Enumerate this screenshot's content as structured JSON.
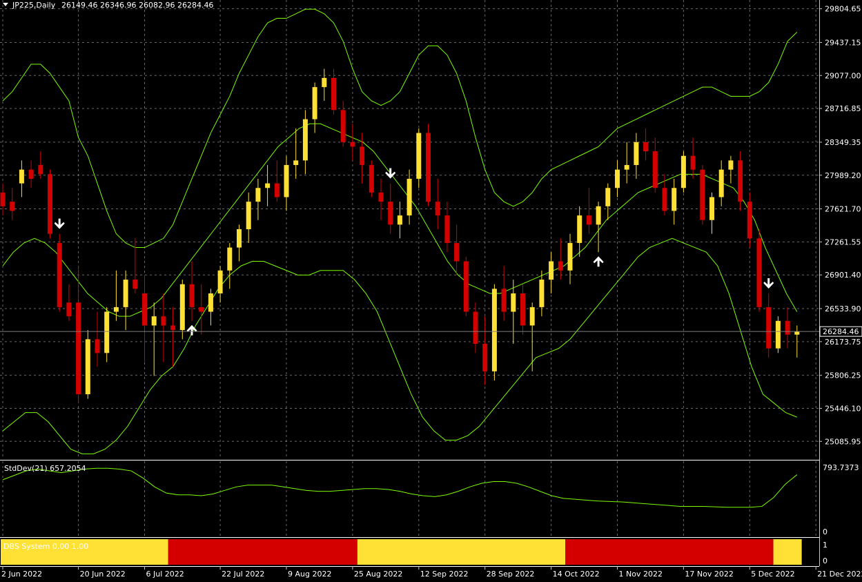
{
  "window": {
    "symbol_label": "JP225,Daily",
    "ohlc_label": "26149.46 26346.96 26082.96 26284.46"
  },
  "colors": {
    "background": "#000000",
    "grid": "#c0c0c0",
    "band": "#7cfc00",
    "candle_up": "#ffe135",
    "candle_down": "#d40000",
    "arrow": "#ffffff",
    "price_line": "#808080",
    "panel_border": "#ffffff"
  },
  "price_axis": {
    "ticks": [
      "29804.65",
      "29437.15",
      "29077.00",
      "28716.85",
      "28349.35",
      "27989.20",
      "27621.70",
      "27261.55",
      "26901.40",
      "26533.90",
      "26173.75",
      "25806.25",
      "25446.10",
      "25085.95"
    ],
    "current_price_label": "26284.46",
    "current_price": 26284.46
  },
  "stddev_panel": {
    "title": "StdDev(21) 657.2054",
    "axis_top": "793.7373",
    "axis_bottom": "0"
  },
  "dbs_panel": {
    "title": "DBS System 0.00 1.00",
    "axis_top": "1",
    "axis_bottom": "0",
    "segments": [
      {
        "state": 1,
        "from": 0,
        "to": 18
      },
      {
        "state": 0,
        "from": 18,
        "to": 38
      },
      {
        "state": 1,
        "from": 38,
        "to": 60
      },
      {
        "state": 0,
        "from": 60,
        "to": 82
      },
      {
        "state": 1,
        "from": 82,
        "to": 86
      }
    ]
  },
  "time_axis": {
    "labels": [
      {
        "text": "2 Jun 2022",
        "bar": 0
      },
      {
        "text": "20 Jun 2022",
        "bar": 8
      },
      {
        "text": "6 Jul 2022",
        "bar": 15
      },
      {
        "text": "22 Jul 2022",
        "bar": 23
      },
      {
        "text": "9 Aug 2022",
        "bar": 30
      },
      {
        "text": "25 Aug 2022",
        "bar": 37
      },
      {
        "text": "12 Sep 2022",
        "bar": 44
      },
      {
        "text": "28 Sep 2022",
        "bar": 51
      },
      {
        "text": "14 Oct 2022",
        "bar": 58
      },
      {
        "text": "1 Nov 2022",
        "bar": 65
      },
      {
        "text": "17 Nov 2022",
        "bar": 72
      },
      {
        "text": "5 Dec 2022",
        "bar": 79
      },
      {
        "text": "21 Dec 2022",
        "bar": 86
      }
    ]
  },
  "chart_data": {
    "type": "candlestick",
    "title": "JP225,Daily",
    "ylim": [
      24900,
      29900
    ],
    "candles": [
      [
        27800,
        27900,
        27550,
        27650
      ],
      [
        27700,
        27850,
        27500,
        27600
      ],
      [
        27900,
        28150,
        27750,
        28050
      ],
      [
        28050,
        28150,
        27850,
        27950
      ],
      [
        28100,
        28250,
        27950,
        28000
      ],
      [
        28000,
        28050,
        27300,
        27350
      ],
      [
        27250,
        27350,
        26500,
        26550
      ],
      [
        26600,
        26800,
        26400,
        26450
      ],
      [
        26600,
        27000,
        25500,
        25600
      ],
      [
        25600,
        26300,
        25550,
        26200
      ],
      [
        26200,
        26500,
        25900,
        26050
      ],
      [
        26050,
        26550,
        25950,
        26500
      ],
      [
        26500,
        26950,
        26400,
        26550
      ],
      [
        26550,
        26950,
        26300,
        26850
      ],
      [
        26850,
        27300,
        26700,
        26750
      ],
      [
        26700,
        26900,
        25950,
        26350
      ],
      [
        26350,
        26600,
        25800,
        26450
      ],
      [
        26450,
        26700,
        25950,
        26350
      ],
      [
        26350,
        26550,
        25900,
        26300
      ],
      [
        26300,
        26850,
        26200,
        26800
      ],
      [
        26800,
        27050,
        26400,
        26550
      ],
      [
        26550,
        26800,
        26250,
        26500
      ],
      [
        26500,
        26750,
        26350,
        26700
      ],
      [
        26700,
        27000,
        26600,
        26950
      ],
      [
        26950,
        27250,
        26750,
        27200
      ],
      [
        27200,
        27450,
        27050,
        27400
      ],
      [
        27400,
        27800,
        27250,
        27700
      ],
      [
        27700,
        27950,
        27500,
        27850
      ],
      [
        27850,
        28100,
        27650,
        27900
      ],
      [
        27900,
        28150,
        27700,
        27750
      ],
      [
        27750,
        28200,
        27600,
        28100
      ],
      [
        28100,
        28500,
        27950,
        28150
      ],
      [
        28150,
        28700,
        28000,
        28600
      ],
      [
        28600,
        29000,
        28450,
        28950
      ],
      [
        28950,
        29150,
        28800,
        29050
      ],
      [
        29050,
        29150,
        28650,
        28700
      ],
      [
        28700,
        28800,
        28300,
        28350
      ],
      [
        28350,
        28550,
        28150,
        28300
      ],
      [
        28300,
        28450,
        27900,
        28100
      ],
      [
        28100,
        28150,
        27750,
        27800
      ],
      [
        27800,
        27950,
        27500,
        27700
      ],
      [
        27700,
        27900,
        27350,
        27450
      ],
      [
        27450,
        27700,
        27300,
        27550
      ],
      [
        27550,
        28050,
        27450,
        27950
      ],
      [
        27950,
        28500,
        27850,
        28450
      ],
      [
        28450,
        28550,
        27650,
        27700
      ],
      [
        27700,
        27950,
        27400,
        27550
      ],
      [
        27550,
        27700,
        27150,
        27250
      ],
      [
        27250,
        27450,
        26900,
        27050
      ],
      [
        27050,
        27100,
        26450,
        26500
      ],
      [
        26500,
        26600,
        26050,
        26150
      ],
      [
        26150,
        26450,
        25700,
        25850
      ],
      [
        25850,
        26800,
        25750,
        26750
      ],
      [
        26750,
        27000,
        26400,
        26500
      ],
      [
        26500,
        26850,
        26150,
        26700
      ],
      [
        26700,
        26800,
        26250,
        26350
      ],
      [
        26350,
        26600,
        25850,
        26550
      ],
      [
        26550,
        26950,
        26450,
        26850
      ],
      [
        26850,
        27150,
        26700,
        27050
      ],
      [
        27050,
        27300,
        26850,
        26950
      ],
      [
        26950,
        27350,
        26800,
        27250
      ],
      [
        27250,
        27650,
        27100,
        27550
      ],
      [
        27550,
        27850,
        27350,
        27450
      ],
      [
        27450,
        27700,
        27150,
        27650
      ],
      [
        27650,
        27900,
        27500,
        27850
      ],
      [
        27850,
        28150,
        27750,
        28050
      ],
      [
        28050,
        28350,
        27900,
        28100
      ],
      [
        28100,
        28450,
        27950,
        28350
      ],
      [
        28350,
        28500,
        28150,
        28250
      ],
      [
        28250,
        28400,
        27800,
        27850
      ],
      [
        27850,
        28000,
        27550,
        27600
      ],
      [
        27600,
        27950,
        27450,
        27850
      ],
      [
        27850,
        28250,
        27800,
        28200
      ],
      [
        28200,
        28400,
        27950,
        28050
      ],
      [
        28050,
        28100,
        27450,
        27500
      ],
      [
        27500,
        27800,
        27350,
        27750
      ],
      [
        27750,
        28150,
        27650,
        28050
      ],
      [
        28050,
        28200,
        27900,
        28150
      ],
      [
        28150,
        28250,
        27600,
        27700
      ],
      [
        27700,
        27800,
        27200,
        27300
      ],
      [
        27300,
        27400,
        26500,
        26550
      ],
      [
        26550,
        26700,
        26000,
        26100
      ],
      [
        26100,
        26450,
        26050,
        26400
      ],
      [
        26400,
        26550,
        26100,
        26250
      ],
      [
        26250,
        26350,
        26000,
        26284.46
      ]
    ],
    "bands_note": "Bollinger-style envelope lines drawn around price",
    "bands": {
      "upper": [
        28800,
        28900,
        29050,
        29200,
        29200,
        29100,
        28950,
        28800,
        28400,
        28200,
        27900,
        27600,
        27350,
        27250,
        27200,
        27200,
        27250,
        27300,
        27450,
        27700,
        27950,
        28200,
        28450,
        28650,
        28850,
        29100,
        29300,
        29500,
        29650,
        29700,
        29700,
        29750,
        29800,
        29800,
        29750,
        29650,
        29450,
        29150,
        28900,
        28800,
        28750,
        28800,
        28900,
        29100,
        29300,
        29400,
        29400,
        29300,
        29100,
        28800,
        28400,
        28050,
        27800,
        27700,
        27650,
        27700,
        27800,
        27950,
        28050,
        28100,
        28150,
        28200,
        28250,
        28300,
        28400,
        28500,
        28550,
        28600,
        28650,
        28700,
        28750,
        28800,
        28850,
        28900,
        28950,
        28950,
        28900,
        28850,
        28850,
        28850,
        28900,
        29000,
        29200,
        29450,
        29550
      ],
      "middle": [
        27000,
        27150,
        27250,
        27300,
        27250,
        27150,
        27000,
        26850,
        26700,
        26600,
        26500,
        26450,
        26450,
        26500,
        26550,
        26650,
        26800,
        26950,
        27100,
        27250,
        27400,
        27550,
        27700,
        27850,
        28000,
        28150,
        28300,
        28400,
        28500,
        28550,
        28550,
        28500,
        28450,
        28400,
        28350,
        28250,
        28100,
        27950,
        27800,
        27650,
        27450,
        27250,
        27050,
        26900,
        26800,
        26750,
        26700,
        26700,
        26750,
        26800,
        26850,
        26900,
        26950,
        27000,
        27100,
        27200,
        27350,
        27500,
        27600,
        27700,
        27800,
        27850,
        27900,
        27950,
        28000,
        28000,
        28000,
        27950,
        27900,
        27850,
        27700,
        27500,
        27200,
        26950,
        26700,
        26500
      ],
      "lower": [
        25200,
        25300,
        25400,
        25400,
        25300,
        25150,
        25000,
        24950,
        24950,
        25000,
        25100,
        25250,
        25450,
        25650,
        25800,
        25900,
        26100,
        26350,
        26550,
        26750,
        26900,
        27000,
        27050,
        27050,
        27000,
        26950,
        26900,
        26900,
        26950,
        26950,
        26950,
        26850,
        26700,
        26500,
        26200,
        25900,
        25600,
        25350,
        25200,
        25100,
        25100,
        25150,
        25250,
        25400,
        25550,
        25700,
        25850,
        26000,
        26050,
        26100,
        26200,
        26350,
        26500,
        26650,
        26800,
        26950,
        27100,
        27200,
        27250,
        27300,
        27250,
        27200,
        27150,
        27000,
        26700,
        26300,
        25900,
        25600,
        25500,
        25400,
        25350
      ]
    },
    "arrows": [
      {
        "bar": 6,
        "direction": "down"
      },
      {
        "bar": 20,
        "direction": "up"
      },
      {
        "bar": 41,
        "direction": "down"
      },
      {
        "bar": 63,
        "direction": "up"
      },
      {
        "bar": 81,
        "direction": "down"
      }
    ],
    "stddev": [
      600,
      650,
      700,
      720,
      700,
      680,
      700,
      720,
      730,
      730,
      720,
      700,
      620,
      520,
      450,
      430,
      430,
      420,
      440,
      480,
      520,
      540,
      540,
      540,
      520,
      500,
      480,
      470,
      470,
      480,
      490,
      500,
      500,
      490,
      470,
      440,
      420,
      410,
      430,
      470,
      520,
      560,
      580,
      580,
      560,
      520,
      470,
      420,
      390,
      380,
      370,
      360,
      355,
      350,
      340,
      330,
      320,
      310,
      300,
      300,
      300,
      295,
      290,
      290,
      290,
      300,
      400,
      550,
      657
    ]
  }
}
